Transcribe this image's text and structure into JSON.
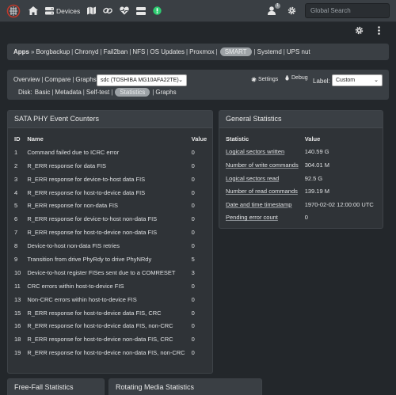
{
  "navbar": {
    "devices_label": "Devices",
    "notification_count": "1",
    "search_placeholder": "Global Search"
  },
  "breadcrumb": {
    "apps_label": "Apps",
    "arrow": "»",
    "items": [
      "Borgbackup",
      "Chronyd",
      "Fail2ban",
      "NFS",
      "OS Updates",
      "Proxmox",
      "SMART",
      "Systemd",
      "UPS nut"
    ],
    "active": "SMART"
  },
  "toolbar": {
    "views": [
      "Overview",
      "Compare",
      "Graphs"
    ],
    "device_select": "sdc (TOSHIBA MG10AFA22TE)",
    "settings_label": "Settings",
    "debug_label": "Debug",
    "label_label": "Label:",
    "label_select": "Custom",
    "disk_prefix": "Disk:",
    "disk_tabs": [
      "Basic",
      "Metadata",
      "Self-test",
      "Statistics",
      "Graphs"
    ],
    "disk_active": "Statistics"
  },
  "sata_phy": {
    "title": "SATA PHY Event Counters",
    "headers": [
      "ID",
      "Name",
      "Value"
    ],
    "rows": [
      [
        "1",
        "Command failed due to ICRC error",
        "0"
      ],
      [
        "2",
        "R_ERR response for data FIS",
        "0"
      ],
      [
        "3",
        "R_ERR response for device-to-host data FIS",
        "0"
      ],
      [
        "4",
        "R_ERR response for host-to-device data FIS",
        "0"
      ],
      [
        "5",
        "R_ERR response for non-data FIS",
        "0"
      ],
      [
        "6",
        "R_ERR response for device-to-host non-data FIS",
        "0"
      ],
      [
        "7",
        "R_ERR response for host-to-device non-data FIS",
        "0"
      ],
      [
        "8",
        "Device-to-host non-data FIS retries",
        "0"
      ],
      [
        "9",
        "Transition from drive PhyRdy to drive PhyNRdy",
        "5"
      ],
      [
        "10",
        "Device-to-host register FISes sent due to a COMRESET",
        "3"
      ],
      [
        "11",
        "CRC errors within host-to-device FIS",
        "0"
      ],
      [
        "13",
        "Non-CRC errors within host-to-device FIS",
        "0"
      ],
      [
        "15",
        "R_ERR response for host-to-device data FIS, CRC",
        "0"
      ],
      [
        "16",
        "R_ERR response for host-to-device data FIS, non-CRC",
        "0"
      ],
      [
        "18",
        "R_ERR response for host-to-device non-data FIS, CRC",
        "0"
      ],
      [
        "19",
        "R_ERR response for host-to-device non-data FIS, non-CRC",
        "0"
      ]
    ]
  },
  "general_stats": {
    "title": "General Statistics",
    "headers": [
      "Statistic",
      "Value"
    ],
    "rows": [
      [
        "Logical sectors written",
        "140.59 G"
      ],
      [
        "Number of write commands",
        "304.01 M"
      ],
      [
        "Logical sectors read",
        "92.5 G"
      ],
      [
        "Number of read commands",
        "139.19 M"
      ],
      [
        "Date and time timestamp",
        "1970-02-02 12:00:00 UTC"
      ],
      [
        "Pending error count",
        "0"
      ]
    ]
  },
  "bottom_cards": {
    "free_fall": "Free-Fall Statistics",
    "rotating": "Rotating Media Statistics"
  },
  "colors": {
    "background": "#23272b",
    "navbar": "#3a3f44",
    "card": "#2f3337",
    "active_pill": "#9da2a6",
    "notification_green": "#2ecc71"
  }
}
